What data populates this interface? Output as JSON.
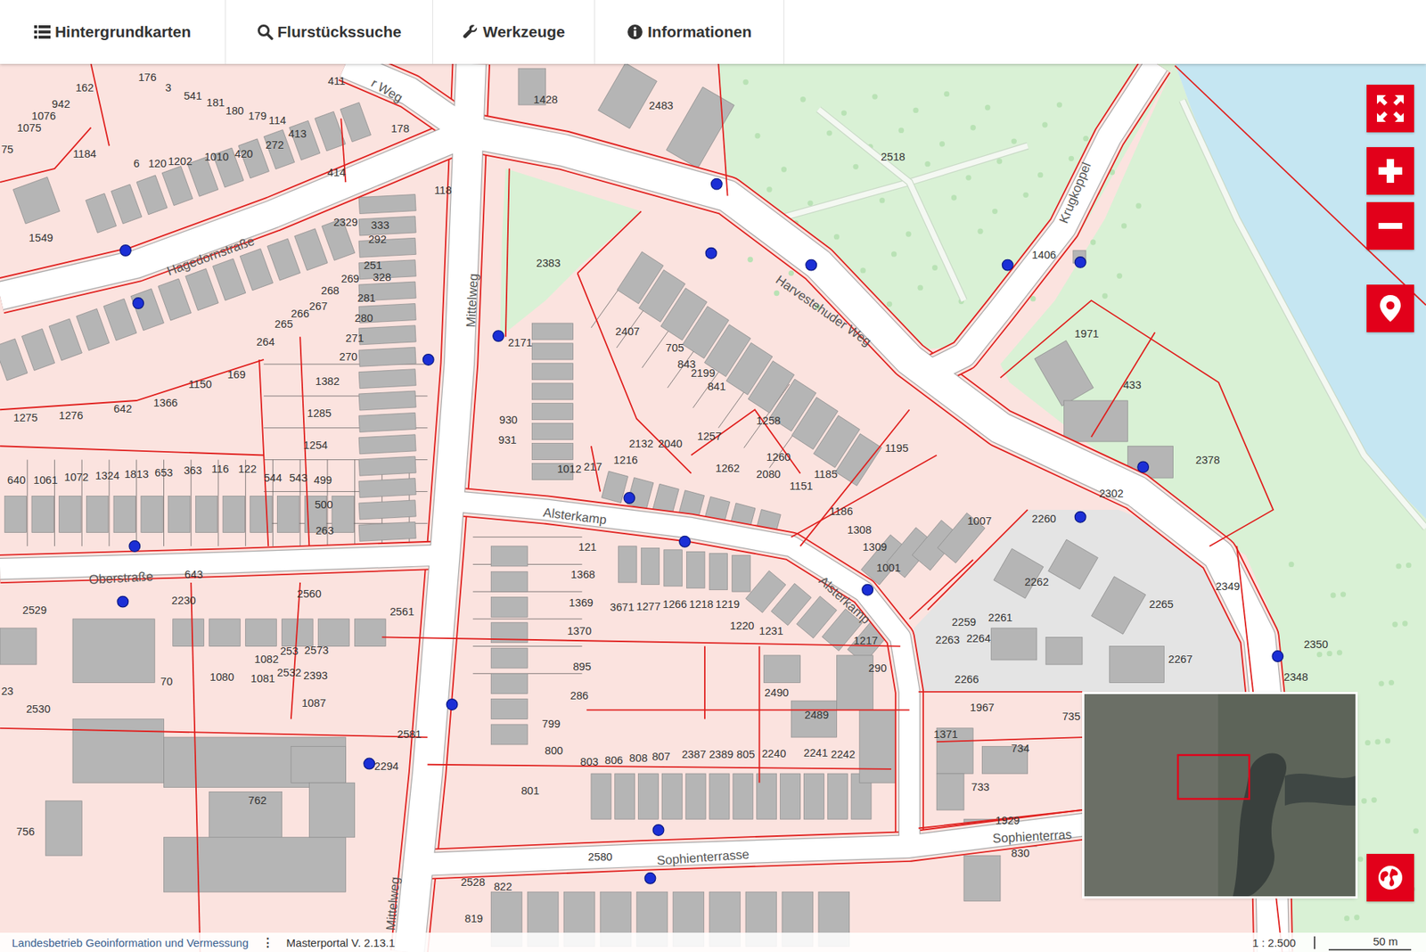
{
  "menu": [
    {
      "label": "Hintergrundkarten"
    },
    {
      "label": "Flurstückssuche"
    },
    {
      "label": "Werkzeuge"
    },
    {
      "label": "Informationen"
    }
  ],
  "map": {
    "street_labels": [
      "r Weg",
      "Hagedornstraße",
      "Mittelweg",
      "Harvestehuder Weg",
      "Krugkoppel",
      "Alsterkamp",
      "Alsterkamp",
      "Oberstraße",
      "Sophienterrasse",
      "Sophienterras",
      "Mittelweg"
    ],
    "parcel_labels": [
      "162",
      "176",
      "3",
      "942",
      "541",
      "411",
      "181",
      "180",
      "179",
      "114",
      "1076",
      "1075",
      "413",
      "272",
      "178",
      "75",
      "1184",
      "6",
      "120",
      "1202",
      "1010",
      "420",
      "414",
      "1549",
      "2329",
      "333",
      "292",
      "251",
      "328",
      "269",
      "268",
      "281",
      "267",
      "266",
      "280",
      "265",
      "271",
      "264",
      "270",
      "169",
      "1150",
      "1382",
      "1366",
      "642",
      "1275",
      "1276",
      "1285",
      "1254",
      "499",
      "500",
      "263",
      "118",
      "640",
      "1061",
      "1072",
      "1324",
      "1813",
      "653",
      "363",
      "116",
      "122",
      "544",
      "543",
      "643",
      "2529",
      "2230",
      "2560",
      "2561",
      "2573",
      "1082",
      "253",
      "2532",
      "2393",
      "70",
      "1080",
      "1081",
      "1087",
      "23",
      "2530",
      "2581",
      "762",
      "756",
      "2294",
      "2383",
      "2171",
      "2407",
      "705",
      "843",
      "2199",
      "841",
      "930",
      "931",
      "1012",
      "217",
      "1216",
      "2132",
      "2040",
      "1257",
      "1258",
      "1262",
      "1260",
      "2080",
      "1185",
      "1151",
      "1195",
      "1186",
      "1308",
      "1309",
      "1001",
      "1007",
      "2260",
      "2262",
      "2265",
      "2259",
      "2261",
      "2263",
      "2264",
      "2266",
      "2267",
      "1967",
      "735",
      "1371",
      "734",
      "733",
      "1929",
      "830",
      "121",
      "1368",
      "1369",
      "1370",
      "3671",
      "1277",
      "1266",
      "1218",
      "1219",
      "1220",
      "1231",
      "1217",
      "895",
      "286",
      "799",
      "800",
      "801",
      "2490",
      "2489",
      "290",
      "803",
      "806",
      "808",
      "807",
      "2387",
      "2389",
      "805",
      "2240",
      "2241",
      "2242",
      "2580",
      "2528",
      "822",
      "819",
      "1428",
      "2483",
      "2518",
      "1406",
      "1971",
      "433",
      "2378",
      "2302",
      "2349",
      "2350",
      "2348"
    ]
  },
  "footer": {
    "provider": "Landesbetrieb Geoinformation und Vermessung",
    "menu_icon": "⋮",
    "version": "Masterportal V. 2.13.1",
    "scale": "1 : 2.500",
    "scalebar": "50 m"
  }
}
